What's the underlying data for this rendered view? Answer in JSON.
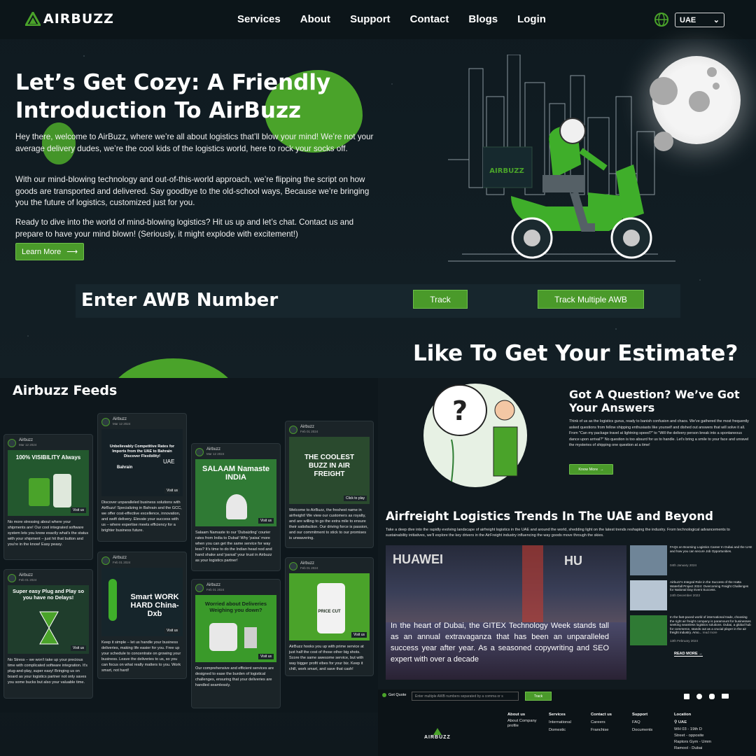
{
  "brand": {
    "name": "AIRBUZZ",
    "accent": "#4a9a2a"
  },
  "nav": {
    "links": [
      "Services",
      "About",
      "Support",
      "Contact",
      "Blogs",
      "Login"
    ],
    "region": "UAE"
  },
  "hero": {
    "title": "Let’s Get Cozy: A Friendly Introduction To AirBuzz",
    "p1": "Hey there, welcome to AirBuzz, where we’re all about logistics that’ll blow your mind! We’re not your average delivery dudes, we’re the cool kids of the logistics world, here to rock your socks off.",
    "p2": "With our mind-blowing technology and out-of-this-world approach, we’re flipping the script on how goods are transported and delivered. Say goodbye to the old-school ways, Because we’re bringing you the future of logistics, customized just for you.",
    "p3": "Ready to dive into the world of mind-blowing logistics? Hit us up and let’s chat. Contact us and prepare to have your mind blown! (Seriously, it might explode with excitement!)",
    "cta": "Learn More",
    "box_label": "AIRBUZZ"
  },
  "awb": {
    "label": "Enter AWB Number",
    "track": "Track",
    "track_multi": "Track Multiple AWB"
  },
  "estimate": "Like To Get Your Estimate?",
  "feeds": {
    "title": "Airbuzz Feeds",
    "visit": "Visit us",
    "cards": [
      {
        "name": "Airbuzz",
        "date": "Mar 12 2024",
        "img": "100% VISIBILITY Always",
        "body": "No more stressing about where your shipments are! Our cool integrated software system lets you know exactly what's the status with your shipment – just hit that button and you're in the know! Easy peasy."
      },
      {
        "name": "Airbuzz",
        "date": "Feb 01 2024",
        "img": "Super easy Plug and Play so you have no Delays!",
        "body": "No Stress – we won't take up your precious time with complicated software integration. It's plug-and-play, super easy! Bringing us on board as your logistics partner not only saves you some bucks but also your valuable time."
      },
      {
        "name": "Airbuzz",
        "date": "Mar 12 2024",
        "img": "Unbelievably Competitive Rates for Imports from the UAE to Bahrain Discover Flexibility!",
        "img2": "Bahrain",
        "img3": "UAE",
        "body": "Discover unparalleled business solutions with AirBuzz! Specializing in Bahrain and the GCC, we offer cost-effective excellence, innovation, and swift delivery. Elevate your success with us – where expertise meets efficiency for a brighter business future."
      },
      {
        "name": "Airbuzz",
        "date": "Feb 01 2024",
        "img": "Smart WORK HARD China-Dxb",
        "body": "Keep it simple – let us handle your business deliveries, making life easier for you. Free up your schedule to concentrate on growing your business. Leave the deliveries to us, so you can focus on what really matters to you. Work smart, not hard!"
      },
      {
        "name": "Airbuzz",
        "date": "Mar 12 2024",
        "img": "SALAAM Namaste INDIA",
        "body": "Salaam Namaste to our 'Dubaizling' courier rates from India to Dubai! Why 'paisa' more when you can get the same service for way less? It's time to do the Indian head nod and hand shake and 'parsal' your trust in Airbuzz as your logistics partner!"
      },
      {
        "name": "Airbuzz",
        "date": "Feb 01 2024",
        "img": "Worried about Deliveries Weighing you down?",
        "body": "Our comprehensive and efficient services are designed to ease the burden of logistical challenges, ensuring that your deliveries are handled seamlessly."
      },
      {
        "name": "Airbuzz",
        "date": "Feb 01 2024",
        "img": "THE COOLEST BUZZ IN AIR FREIGHT",
        "img2": "Click to play",
        "body": "Welcome to AirBuzz, the freshest name in airfreight! We view our customers as royalty, and are willing to go the extra mile to ensure their satisfaction. Our driving force is passion, and our commitment to stick to our promises is unwavering."
      },
      {
        "name": "Airbuzz",
        "date": "Feb 01 2024",
        "img": "PRICE CUT",
        "body": "AirBuzz hooks you up with prime service at just half the cost of those other big shots. Score the same awesome service, but with way bigger profit vibes for your biz. Keep it chill, work smart, and save that cash!"
      }
    ]
  },
  "faq": {
    "title": "Got A Question? We’ve Got Your Answers",
    "p": "Think of us as the logistics gurus, ready to banish confusion and chaos. We've gathered the most frequently asked questions from fellow shipping enthusiasts like yourself and dished out answers that will solve it all. From \"Can my package travel at lightning speed?\" to \"Will the delivery person break into a spontaneous dance upon arrival?\" No question is too absurd for us to handle. Let's bring a smile to your face and unravel the mysteries of shipping one question at a time!",
    "cta": "Know More"
  },
  "trends": {
    "title": "Airfreight Logistics Trends In The UAE and Beyond",
    "p": "Take a deep dive into the rapidly evolving landscape of airfreight logistics in the UAE and around the world, shedding light on the latest trends reshaping the industry. From technological advancements to sustainability initiatives, we'll explore the key drivers in the AirFreight industry influencing the way goods move through the skies.",
    "img_sign1": "HUAWEI",
    "img_sign2": "HU",
    "caption": "In the heart of Dubai, the GITEX Technology Week stands tall as an annual extravaganza that has been an unparalleled success year after year. As a seasoned copywriting and SEO expert with over a decade",
    "news": [
      {
        "title": "FAQs on Booming Logistics Career In Dubai and the UAE and how you can secure Job Opportunities.",
        "date": "04th January 2024"
      },
      {
        "title": "Airbuzz's Integral Role in the Success of the Hatta Waterfall Project 2024: Overcoming Freight Challenges for National Day Event Success.",
        "date": "24th December 2023"
      },
      {
        "title": "In the fast-paced world of international trade, choosing the right air freight company is paramount for businesses seeking seamless logistics solutions. Dubai, a global hub for commerce, stands out as a crucial player in the air freight industry. Amo...",
        "more": "read more",
        "date": "13th February 2024"
      }
    ],
    "readmore": "READ MORE →"
  },
  "footer": {
    "getquote": "Get Quote",
    "placeholder": "Enter multiple AWB numbers separated by a comma or s",
    "track": "Track",
    "cols": [
      {
        "h": "About us",
        "items": [
          "About Company profile"
        ]
      },
      {
        "h": "Services",
        "items": [
          "International",
          "Domestic"
        ]
      },
      {
        "h": "Contact us",
        "items": [
          "Careers",
          "Franchise"
        ]
      },
      {
        "h": "Support",
        "items": [
          "FAQ",
          "Documents"
        ]
      }
    ],
    "loc_h": "Location",
    "loc_country": "UAE",
    "loc_addr": "WH 03 - 19th D Street - opposite Raptors Gym - Umm Ramool - Dubai",
    "logo": "AIRBUZZ",
    "socials": [
      "linkedin-icon",
      "facebook-icon",
      "instagram-icon",
      "youtube-icon"
    ]
  }
}
